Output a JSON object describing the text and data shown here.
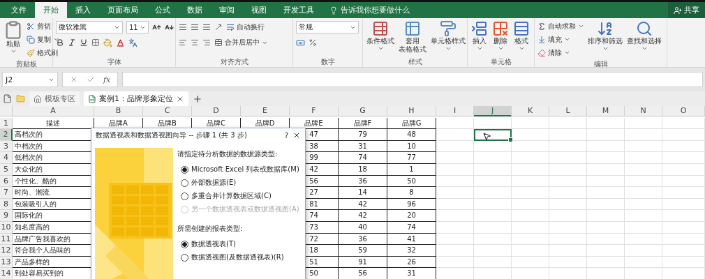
{
  "menu_tabs": [
    {
      "label": "文件",
      "selected": false
    },
    {
      "label": "开始",
      "selected": true
    },
    {
      "label": "插入",
      "selected": false
    },
    {
      "label": "页面布局",
      "selected": false
    },
    {
      "label": "公式",
      "selected": false
    },
    {
      "label": "数据",
      "selected": false
    },
    {
      "label": "审阅",
      "selected": false
    },
    {
      "label": "视图",
      "selected": false
    },
    {
      "label": "开发工具",
      "selected": false
    }
  ],
  "tell_me": "告诉我你想要做什么",
  "share": "共享",
  "ribbon": {
    "clipboard": {
      "paste": "粘贴",
      "cut": "剪切",
      "copy": "复制",
      "format_painter": "格式刷",
      "label": "剪贴板"
    },
    "font": {
      "name": "微软雅黑",
      "size": "11",
      "label": "字体"
    },
    "alignment": {
      "wrap_text": "自动换行",
      "merge_center": "合并后居中",
      "label": "对齐方式"
    },
    "number": {
      "format": "常规",
      "label": "数字"
    },
    "styles": {
      "conditional": "条件格式",
      "table_format": [
        "套用",
        "表格格式"
      ],
      "cell_styles": "单元格样式",
      "label": "样式"
    },
    "cells": {
      "insert": "插入",
      "delete": "删除",
      "format": "格式",
      "label": "单元格"
    },
    "editing": {
      "autosum": "自动求和",
      "fill": "填充",
      "clear": "清除",
      "sort_filter": "排序和筛选",
      "find_select": "查找和选择",
      "label": "编辑"
    }
  },
  "formula_bar": {
    "name_box": "J2",
    "function_label": "fx"
  },
  "doc_tabs": [
    {
      "kind": "home",
      "label": "模板专区",
      "selected": false
    },
    {
      "kind": "workbook",
      "label": "案例1：品牌形象定位",
      "selected": true
    }
  ],
  "columns": [
    {
      "label": "A",
      "selected": false
    },
    {
      "label": "B",
      "selected": false
    },
    {
      "label": "C",
      "selected": false
    },
    {
      "label": "D",
      "selected": false
    },
    {
      "label": "E",
      "selected": false
    },
    {
      "label": "F",
      "selected": false
    },
    {
      "label": "G",
      "selected": false
    },
    {
      "label": "H",
      "selected": false
    },
    {
      "label": "I",
      "selected": false
    },
    {
      "label": "J",
      "selected": true
    },
    {
      "label": "K",
      "selected": false
    },
    {
      "label": "L",
      "selected": false
    },
    {
      "label": "M",
      "selected": false
    },
    {
      "label": "N",
      "selected": false
    },
    {
      "label": "O",
      "selected": false
    }
  ],
  "header_row": {
    "number": "1",
    "cells": [
      "描述",
      "品牌A",
      "品牌B",
      "品牌C",
      "品牌D",
      "品牌E",
      "品牌F",
      "品牌G"
    ]
  },
  "rows": [
    {
      "number": "2",
      "selected": true,
      "description": "高档次的",
      "values": [
        "47",
        "79",
        "48"
      ]
    },
    {
      "number": "3",
      "selected": false,
      "description": "中档次的",
      "values": [
        "38",
        "31",
        "10"
      ]
    },
    {
      "number": "4",
      "selected": false,
      "description": "低档次的",
      "values": [
        "99",
        "74",
        "77"
      ]
    },
    {
      "number": "5",
      "selected": false,
      "description": "大众化的",
      "values": [
        "42",
        "18",
        "1"
      ]
    },
    {
      "number": "6",
      "selected": false,
      "description": "个性化、酷的",
      "values": [
        "56",
        "36",
        "50"
      ]
    },
    {
      "number": "7",
      "selected": false,
      "description": "时尚、潮流",
      "values": [
        "27",
        "14",
        "8"
      ]
    },
    {
      "number": "8",
      "selected": false,
      "description": "包装吸引人的",
      "values": [
        "81",
        "42",
        "96"
      ]
    },
    {
      "number": "9",
      "selected": false,
      "description": "国际化的",
      "values": [
        "74",
        "42",
        "20"
      ]
    },
    {
      "number": "10",
      "selected": false,
      "description": "知名度高的",
      "values": [
        "73",
        "40",
        "74"
      ]
    },
    {
      "number": "11",
      "selected": false,
      "description": "品牌广告我喜欢的",
      "values": [
        "72",
        "36",
        "41"
      ]
    },
    {
      "number": "12",
      "selected": false,
      "description": "符合我个人品味的",
      "values": [
        "18",
        "59",
        "32"
      ]
    },
    {
      "number": "13",
      "selected": false,
      "description": "产品多样的",
      "values": [
        "51",
        "91",
        "26"
      ]
    },
    {
      "number": "14",
      "selected": false,
      "description": "到处容易买到的",
      "values": [
        "50",
        "56",
        "31"
      ]
    }
  ],
  "dialog": {
    "title": "数据透视表和数据透视图向导 -- 步骤 1 (共 3 步)",
    "help": "?",
    "source_prompt": "请指定待分析数据的数据源类型:",
    "source_options": [
      {
        "label": "Microsoft Excel 列表或数据库(M)",
        "selected": true,
        "disabled": false
      },
      {
        "label": "外部数据源(E)",
        "selected": false,
        "disabled": false
      },
      {
        "label": "多重合并计算数据区域(C)",
        "selected": false,
        "disabled": false
      },
      {
        "label": "另一个数据透视表或数据透视图(A)",
        "selected": false,
        "disabled": true
      }
    ],
    "report_prompt": "所需创建的报表类型:",
    "report_options": [
      {
        "label": "数据透视表(T)",
        "selected": true,
        "disabled": false
      },
      {
        "label": "数据透视图(及数据透视表)(R)",
        "selected": false,
        "disabled": false
      }
    ]
  }
}
